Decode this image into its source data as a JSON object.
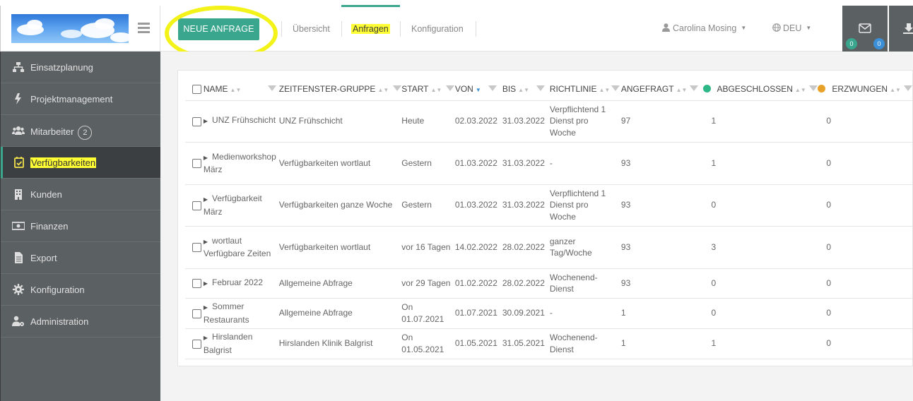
{
  "header": {
    "new_request_label": "NEUE ANFRAGE",
    "nav": [
      "Übersicht",
      "Anfragen",
      "Konfiguration"
    ],
    "active_nav": "Anfragen",
    "user_name": "Carolina Mosing",
    "language": "DEU",
    "mail_badges": [
      "0",
      "0"
    ]
  },
  "sidebar": {
    "items": [
      {
        "label": "Einsatzplanung",
        "icon": "sitemap-icon"
      },
      {
        "label": "Projektmanagement",
        "icon": "bolt-icon"
      },
      {
        "label": "Mitarbeiter",
        "icon": "users-icon",
        "badge": "2"
      },
      {
        "label": "Verfügbarkeiten",
        "icon": "calendar-check-icon"
      },
      {
        "label": "Kunden",
        "icon": "building-icon"
      },
      {
        "label": "Finanzen",
        "icon": "money-icon"
      },
      {
        "label": "Export",
        "icon": "file-icon"
      },
      {
        "label": "Konfiguration",
        "icon": "gear-icon"
      },
      {
        "label": "Administration",
        "icon": "user-gear-icon"
      }
    ],
    "active": "Verfügbarkeiten"
  },
  "table": {
    "columns": [
      "NAME",
      "ZEITFENSTER-GRUPPE",
      "START",
      "VON",
      "BIS",
      "RICHTLINIE",
      "ANGEFRAGT",
      "ABGESCHLOSSEN",
      "ERZWUNGEN"
    ],
    "status_colors": {
      "abgeschlossen": "#2fb887",
      "erzwungen": "#e8a22a"
    },
    "rows": [
      {
        "name": "UNZ Frühschicht",
        "gruppe": "UNZ Frühschicht",
        "start": "Heute",
        "von": "02.03.2022",
        "bis": "31.03.2022",
        "richtlinie": "Verpflichtend 1 Dienst pro Woche",
        "angefragt": "97",
        "abgeschlossen": "1",
        "erzwungen": "0"
      },
      {
        "name": "Medienworkshop März",
        "gruppe": "Verfügbarkeiten wortlaut",
        "start": "Gestern",
        "von": "01.03.2022",
        "bis": "31.03.2022",
        "richtlinie": "-",
        "angefragt": "93",
        "abgeschlossen": "1",
        "erzwungen": "0"
      },
      {
        "name": "Verfügbarkeit März",
        "gruppe": "Verfügbarkeiten ganze Woche",
        "start": "Gestern",
        "von": "01.03.2022",
        "bis": "31.03.2022",
        "richtlinie": "Verpflichtend 1 Dienst pro Woche",
        "angefragt": "93",
        "abgeschlossen": "0",
        "erzwungen": "0"
      },
      {
        "name": "wortlaut Verfügbare Zeiten",
        "gruppe": "Verfügbarkeiten wortlaut",
        "start": "vor 16 Tagen",
        "von": "14.02.2022",
        "bis": "28.02.2022",
        "richtlinie": "ganzer Tag/Woche",
        "angefragt": "93",
        "abgeschlossen": "3",
        "erzwungen": "0"
      },
      {
        "name": "Februar 2022",
        "gruppe": "Allgemeine Abfrage",
        "start": "vor 29 Tagen",
        "von": "01.02.2022",
        "bis": "28.02.2022",
        "richtlinie": "Wochenend-Dienst",
        "angefragt": "93",
        "abgeschlossen": "0",
        "erzwungen": "0"
      },
      {
        "name": "Sommer Restaurants",
        "gruppe": "Allgemeine Abfrage",
        "start": "On 01.07.2021",
        "von": "01.07.2021",
        "bis": "30.09.2021",
        "richtlinie": "-",
        "angefragt": "1",
        "abgeschlossen": "0",
        "erzwungen": "0"
      },
      {
        "name": "Hirslanden Balgrist",
        "gruppe": "Hirslanden Klinik Balgrist",
        "start": "On 01.05.2021",
        "von": "01.05.2021",
        "bis": "31.05.2021",
        "richtlinie": "Wochenend-Dienst",
        "angefragt": "1",
        "abgeschlossen": "1",
        "erzwungen": "0"
      }
    ]
  }
}
